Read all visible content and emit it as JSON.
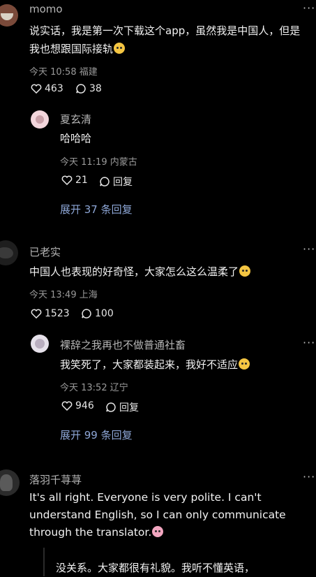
{
  "comments": [
    {
      "username": "momo",
      "text": "说实话，我是第一次下载这个app，虽然我是中国人，但是我也想跟国际接轨",
      "meta": "今天 10:58 福建",
      "likes": "463",
      "replies": "38",
      "reply": {
        "username": "夏玄清",
        "text": "哈哈哈",
        "meta": "今天 11:19 内蒙古",
        "likes": "21",
        "reply_label": "回复"
      },
      "expand": "展开 37 条回复"
    },
    {
      "username": "已老实",
      "text": "中国人也表现的好奇怪，大家怎么这么温柔了",
      "meta": "今天 13:49 上海",
      "likes": "1523",
      "replies": "100",
      "reply": {
        "username": "裸辞之我再也不做普通社畜",
        "text": "我笑死了，大家都装起来，我好不适应",
        "meta": "今天 13:52 辽宁",
        "likes": "946",
        "reply_label": "回复"
      },
      "expand": "展开 99 条回复"
    },
    {
      "username": "落羽千荨荨",
      "text": "It's all right. Everyone is very polite. I can't understand English, so I can only communicate through the translator.",
      "translation": "没关系。大家都很有礼貌。我听不懂英语，"
    }
  ],
  "more_icon": "more-dots-icon",
  "colors": {
    "background": "#000000",
    "link": "#8da6d6",
    "meta": "#9a9a9a"
  }
}
